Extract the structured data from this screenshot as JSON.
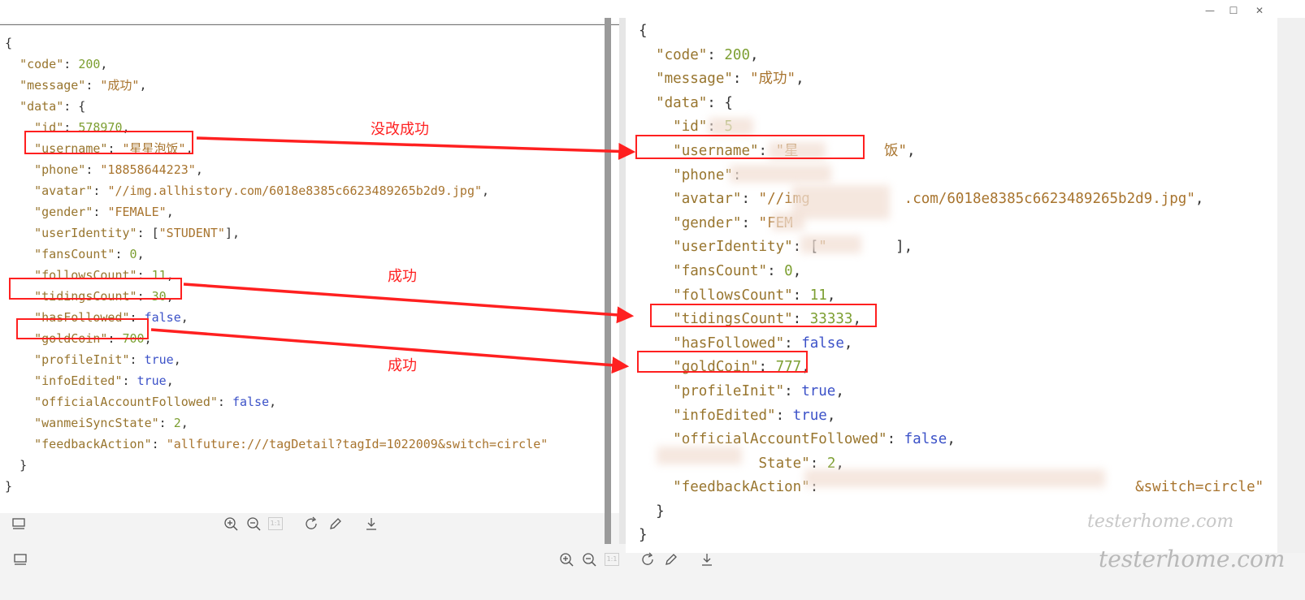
{
  "window": {
    "minimize_glyph": "—",
    "maximize_glyph": "☐",
    "close_glyph": "✕"
  },
  "left_json": {
    "open": "{",
    "lines": [
      [
        [
          "k",
          "\"code\""
        ],
        [
          "p",
          ": "
        ],
        [
          "n",
          "200"
        ],
        [
          "p",
          ","
        ]
      ],
      [
        [
          "k",
          "\"message\""
        ],
        [
          "p",
          ": "
        ],
        [
          "s",
          "\"成功\""
        ],
        [
          "p",
          ","
        ]
      ],
      [
        [
          "k",
          "\"data\""
        ],
        [
          "p",
          ": {"
        ]
      ],
      [
        [
          "k",
          "\"id\""
        ],
        [
          "p",
          ": "
        ],
        [
          "n",
          "578970"
        ],
        [
          "p",
          ","
        ]
      ],
      [
        [
          "k",
          "\"username\""
        ],
        [
          "p",
          ": "
        ],
        [
          "s",
          "\"星星泡饭\""
        ],
        [
          "p",
          ","
        ]
      ],
      [
        [
          "k",
          "\"phone\""
        ],
        [
          "p",
          ": "
        ],
        [
          "s",
          "\"18858644223\""
        ],
        [
          "p",
          ","
        ]
      ],
      [
        [
          "k",
          "\"avatar\""
        ],
        [
          "p",
          ": "
        ],
        [
          "s",
          "\"//img.allhistory.com/6018e8385c6623489265b2d9.jpg\""
        ],
        [
          "p",
          ","
        ]
      ],
      [
        [
          "k",
          "\"gender\""
        ],
        [
          "p",
          ": "
        ],
        [
          "s",
          "\"FEMALE\""
        ],
        [
          "p",
          ","
        ]
      ],
      [
        [
          "k",
          "\"userIdentity\""
        ],
        [
          "p",
          ": ["
        ],
        [
          "s",
          "\"STUDENT\""
        ],
        [
          "p",
          "],"
        ]
      ],
      [
        [
          "k",
          "\"fansCount\""
        ],
        [
          "p",
          ": "
        ],
        [
          "n",
          "0"
        ],
        [
          "p",
          ","
        ]
      ],
      [
        [
          "k",
          "\"followsCount\""
        ],
        [
          "p",
          ": "
        ],
        [
          "n",
          "11"
        ],
        [
          "p",
          ","
        ]
      ],
      [
        [
          "k",
          "\"tidingsCount\""
        ],
        [
          "p",
          ": "
        ],
        [
          "n",
          "30"
        ],
        [
          "p",
          ","
        ]
      ],
      [
        [
          "k",
          "\"hasFollowed\""
        ],
        [
          "p",
          ": "
        ],
        [
          "b",
          "false"
        ],
        [
          "p",
          ","
        ]
      ],
      [
        [
          "k",
          "\"goldCoin\""
        ],
        [
          "p",
          ": "
        ],
        [
          "n",
          "700"
        ],
        [
          "p",
          ","
        ]
      ],
      [
        [
          "k",
          "\"profileInit\""
        ],
        [
          "p",
          ": "
        ],
        [
          "b",
          "true"
        ],
        [
          "p",
          ","
        ]
      ],
      [
        [
          "k",
          "\"infoEdited\""
        ],
        [
          "p",
          ": "
        ],
        [
          "b",
          "true"
        ],
        [
          "p",
          ","
        ]
      ],
      [
        [
          "k",
          "\"officialAccountFollowed\""
        ],
        [
          "p",
          ": "
        ],
        [
          "b",
          "false"
        ],
        [
          "p",
          ","
        ]
      ],
      [
        [
          "k",
          "\"wanmeiSyncState\""
        ],
        [
          "p",
          ": "
        ],
        [
          "n",
          "2"
        ],
        [
          "p",
          ","
        ]
      ],
      [
        [
          "k",
          "\"feedbackAction\""
        ],
        [
          "p",
          ": "
        ],
        [
          "s",
          "\"allfuture:///tagDetail?tagId=1022009&switch=circle\""
        ]
      ],
      [
        [
          "p",
          "}"
        ]
      ]
    ],
    "indents": [
      1,
      1,
      1,
      2,
      2,
      2,
      2,
      2,
      2,
      2,
      2,
      2,
      2,
      2,
      2,
      2,
      2,
      2,
      2,
      1
    ],
    "close": "}"
  },
  "right_json": {
    "open": "{",
    "lines": [
      [
        [
          "k",
          "\"code\""
        ],
        [
          "p",
          ": "
        ],
        [
          "n",
          "200"
        ],
        [
          "p",
          ","
        ]
      ],
      [
        [
          "k",
          "\"message\""
        ],
        [
          "p",
          ": "
        ],
        [
          "s",
          "\"成功\""
        ],
        [
          "p",
          ","
        ]
      ],
      [
        [
          "k",
          "\"data\""
        ],
        [
          "p",
          ": {"
        ]
      ],
      [
        [
          "k",
          "\"id\""
        ],
        [
          "p",
          ": "
        ],
        [
          "n",
          "5"
        ]
      ],
      [
        [
          "k",
          "\"username\""
        ],
        [
          "p",
          ": "
        ],
        [
          "s",
          "\"星"
        ],
        [
          "p",
          "          "
        ],
        [
          "s",
          "饭\""
        ],
        [
          "p",
          ","
        ]
      ],
      [
        [
          "k",
          "\"phone\""
        ],
        [
          "p",
          ": "
        ]
      ],
      [
        [
          "k",
          "\"avatar\""
        ],
        [
          "p",
          ": "
        ],
        [
          "s",
          "\"//img"
        ],
        [
          "p",
          "           "
        ],
        [
          "s",
          ".com/6018e8385c6623489265b2d9.jpg\""
        ],
        [
          "p",
          ","
        ]
      ],
      [
        [
          "k",
          "\"gender\""
        ],
        [
          "p",
          ": "
        ],
        [
          "s",
          "\"FEM"
        ]
      ],
      [
        [
          "k",
          "\"userIdentity\""
        ],
        [
          "p",
          ": ["
        ],
        [
          "s",
          "\""
        ],
        [
          "p",
          "        "
        ],
        [
          "p",
          "],"
        ]
      ],
      [
        [
          "k",
          "\"fansCount\""
        ],
        [
          "p",
          ": "
        ],
        [
          "n",
          "0"
        ],
        [
          "p",
          ","
        ]
      ],
      [
        [
          "k",
          "\"followsCount\""
        ],
        [
          "p",
          ": "
        ],
        [
          "n",
          "11"
        ],
        [
          "p",
          ","
        ]
      ],
      [
        [
          "k",
          "\"tidingsCount\""
        ],
        [
          "p",
          ": "
        ],
        [
          "n",
          "33333"
        ],
        [
          "p",
          ","
        ]
      ],
      [
        [
          "k",
          "\"hasFollowed\""
        ],
        [
          "p",
          ": "
        ],
        [
          "b",
          "false"
        ],
        [
          "p",
          ","
        ]
      ],
      [
        [
          "k",
          "\"goldCoin\""
        ],
        [
          "p",
          ": "
        ],
        [
          "n",
          "777"
        ],
        [
          "p",
          ","
        ]
      ],
      [
        [
          "k",
          "\"profileInit\""
        ],
        [
          "p",
          ": "
        ],
        [
          "b",
          "true"
        ],
        [
          "p",
          ","
        ]
      ],
      [
        [
          "k",
          "\"infoEdited\""
        ],
        [
          "p",
          ": "
        ],
        [
          "b",
          "true"
        ],
        [
          "p",
          ","
        ]
      ],
      [
        [
          "k",
          "\"officialAccountFollowed\""
        ],
        [
          "p",
          ": "
        ],
        [
          "b",
          "false"
        ],
        [
          "p",
          ","
        ]
      ],
      [
        [
          "p",
          "          "
        ],
        [
          "k",
          "State\""
        ],
        [
          "p",
          ": "
        ],
        [
          "n",
          "2"
        ],
        [
          "p",
          ","
        ]
      ],
      [
        [
          "k",
          "\"feedbackAction\""
        ],
        [
          "p",
          ": "
        ],
        [
          "p",
          "                                    "
        ],
        [
          "s",
          "&switch=circle\""
        ]
      ],
      [
        [
          "p",
          "}"
        ]
      ]
    ],
    "indents": [
      1,
      1,
      1,
      2,
      2,
      2,
      2,
      2,
      2,
      2,
      2,
      2,
      2,
      2,
      2,
      2,
      2,
      2,
      2,
      1
    ],
    "close": "}"
  },
  "annotations": {
    "username": "没改成功",
    "tidings": "成功",
    "gold": "成功"
  },
  "toolbar": {
    "fit_label": "1:1"
  },
  "watermark": "testerhome.com",
  "colors": {
    "annotation": "#ff2020",
    "key": "#98752e",
    "string": "#a8742e",
    "number": "#7d9f32",
    "boolean": "#3c52c8"
  }
}
